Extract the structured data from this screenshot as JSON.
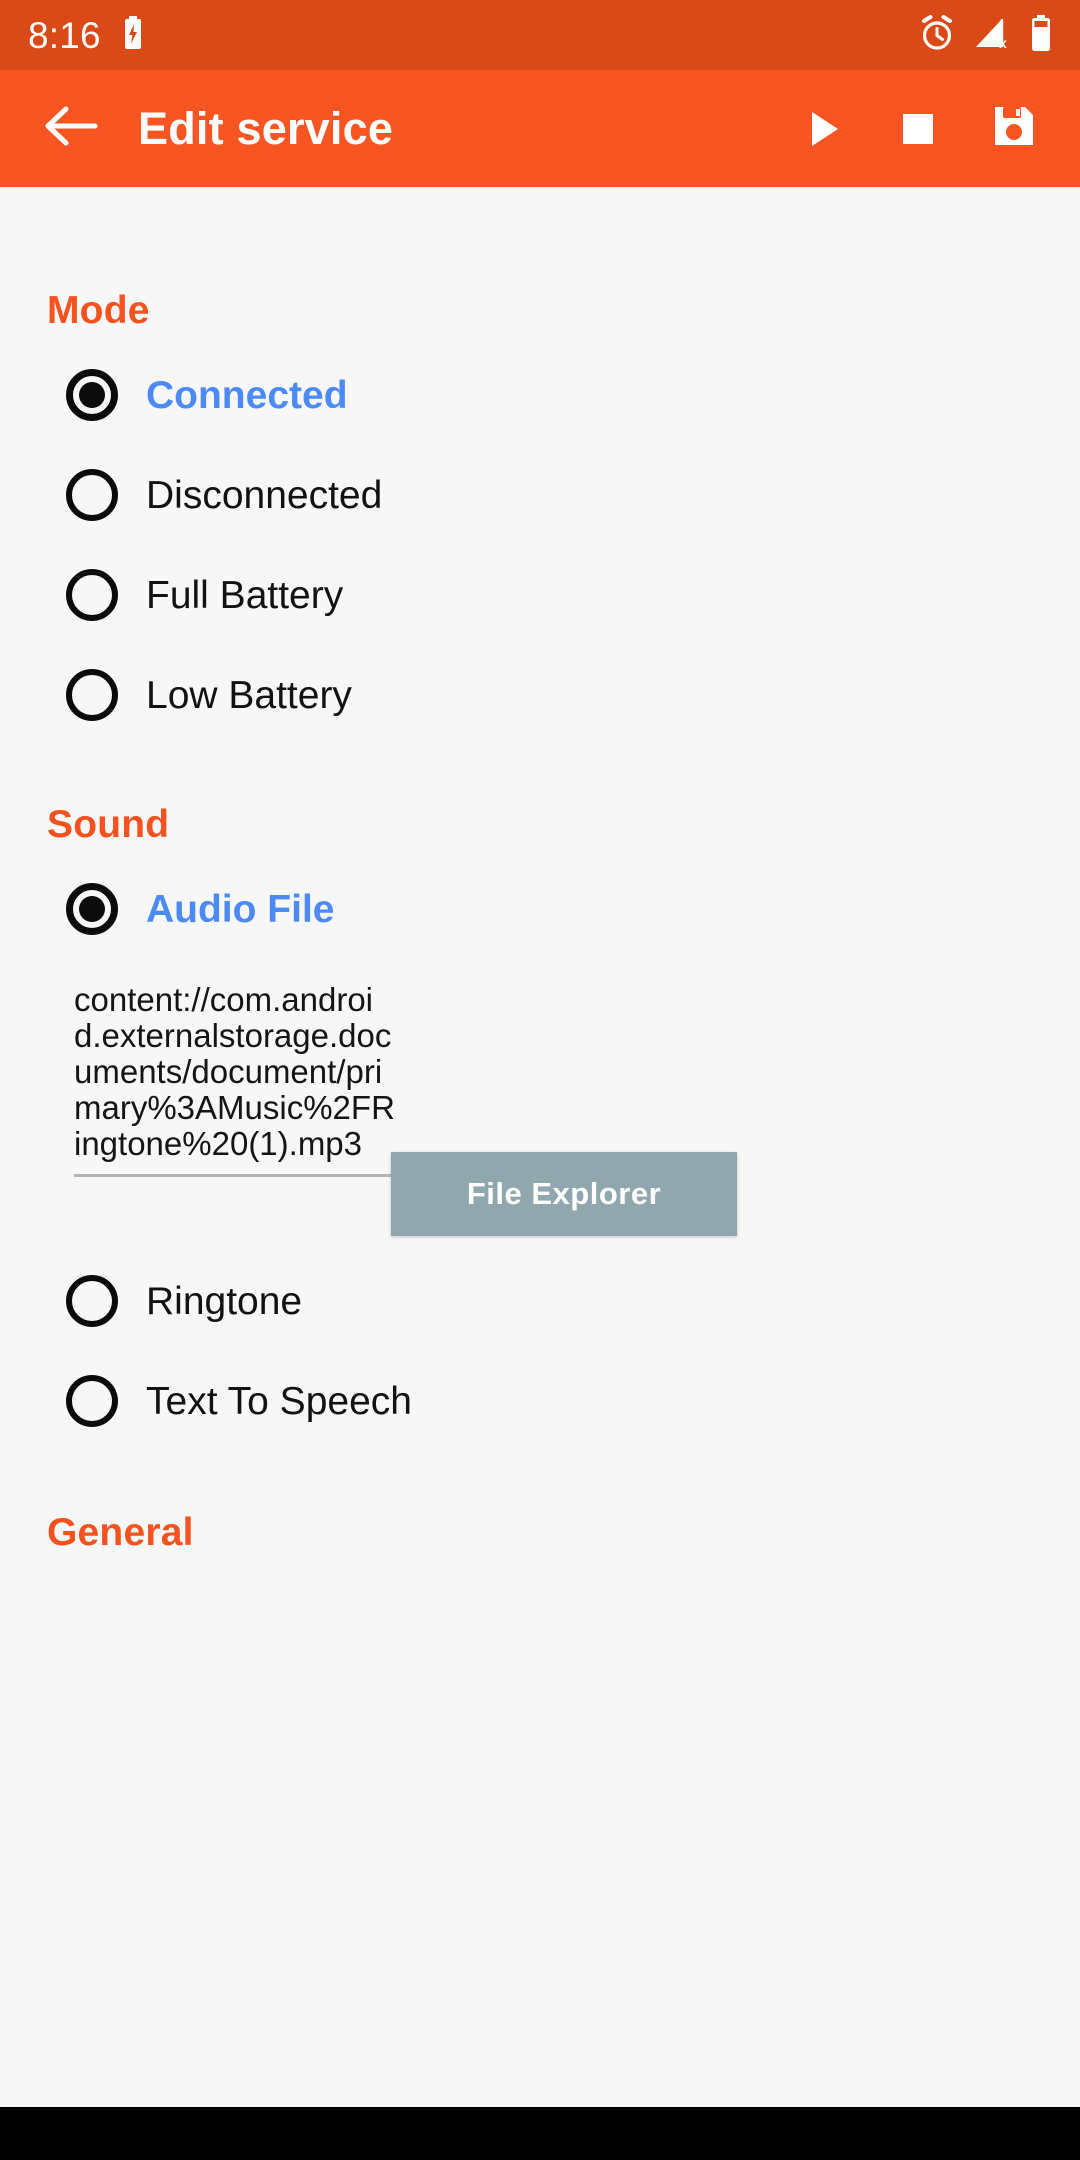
{
  "status_bar": {
    "time": "8:16",
    "background_color": "#DA4A18",
    "icons": [
      {
        "name": "battery-charging-icon",
        "position": "left"
      },
      {
        "name": "alarm-clock-icon",
        "position": "right"
      },
      {
        "name": "no-signal-x-icon",
        "position": "right"
      },
      {
        "name": "battery-icon",
        "position": "right"
      }
    ]
  },
  "app_bar": {
    "title": "Edit service",
    "background_color": "#F95523",
    "back_icon": "back-arrow-icon",
    "actions": [
      {
        "name": "play-icon",
        "label": "Play"
      },
      {
        "name": "stop-icon",
        "label": "Stop"
      },
      {
        "name": "save-icon",
        "label": "Save"
      }
    ]
  },
  "accent_colors": {
    "section_header": "#F4521F",
    "selected_label": "#4C8BF5",
    "button": "#90A7AE",
    "page_background": "#F7F7F7"
  },
  "sections": {
    "mode": {
      "header": "Mode",
      "options": [
        {
          "label": "Connected",
          "selected": true
        },
        {
          "label": "Disconnected",
          "selected": false
        },
        {
          "label": "Full Battery",
          "selected": false
        },
        {
          "label": "Low Battery",
          "selected": false
        }
      ]
    },
    "sound": {
      "header": "Sound",
      "options": [
        {
          "label": "Audio File",
          "selected": true
        },
        {
          "label": "Ringtone",
          "selected": false
        },
        {
          "label": "Text To Speech",
          "selected": false
        }
      ],
      "audio_file_uri": "content://com.android.externalstorage.documents/document/primary%3AMusic%2FRingtone%20(1).mp3",
      "file_explorer_button": "File Explorer"
    },
    "general": {
      "header": "General"
    }
  }
}
